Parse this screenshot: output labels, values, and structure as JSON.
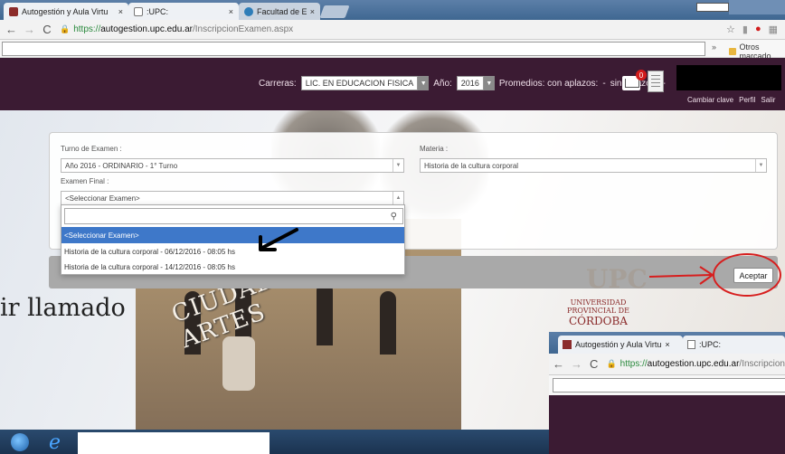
{
  "browser": {
    "tabs": [
      {
        "label": "Autogestión y Aula Virtu",
        "close": "×"
      },
      {
        "label": ":UPC:",
        "close": "×"
      },
      {
        "label": "Facultad de Educación y",
        "close": "×"
      }
    ],
    "url": {
      "proto": "https://",
      "host": "autogestion.upc.edu.ar",
      "path": "/InscripcionExamen.aspx"
    },
    "bookmarks_more": "»",
    "bookmarks_folder": "Otros marcado"
  },
  "header": {
    "carreras_label": "Carreras:",
    "carrera_value": "LIC. EN EDUCACION FISICA",
    "anio_label": "Año:",
    "anio_value": "2016",
    "promedios_label": "Promedios: con aplazos:",
    "promedio_con": "-",
    "sin_aplazos_label": "sin aplazos:",
    "promedio_sin": "-",
    "mail_badge": "0",
    "links": [
      "Cambiar clave",
      "Perfil",
      "Salir"
    ]
  },
  "form": {
    "turno_label": "Turno de Examen :",
    "turno_value": "Año 2016 - ORDINARIO - 1° Turno",
    "materia_label": "Materia :",
    "materia_value": "Historia de la cultura corporal",
    "examen_label": "Examen Final :",
    "examen_value": "<Seleccionar Examen>",
    "dropdown_options": [
      "<Seleccionar Examen>",
      "Historia de la cultura corporal - 06/12/2016 - 08:05 hs",
      "Historia de la cultura corporal - 14/12/2016 - 08:05 hs"
    ],
    "accept_label": "Aceptar"
  },
  "background": {
    "arch_text": "CIUDAD DE LAS ARTES",
    "slide_text": "ir llamado",
    "logo_text": "UPC",
    "univ_lines": [
      "UNIVERSIDAD",
      "PROVINCIAL DE",
      "CÓRDOBA"
    ]
  },
  "mini_browser": {
    "tabs": [
      {
        "label": "Autogestión y Aula Virtu",
        "close": "×"
      },
      {
        "label": ":UPC:",
        "close": ""
      }
    ],
    "url": {
      "proto": "https://",
      "host": "autogestion.upc.edu.ar",
      "path": "/Inscripcion"
    }
  },
  "colors": {
    "header_bg": "#3b1b33",
    "selected_option": "#3e78c9",
    "annotation_red": "#d71e1e"
  }
}
